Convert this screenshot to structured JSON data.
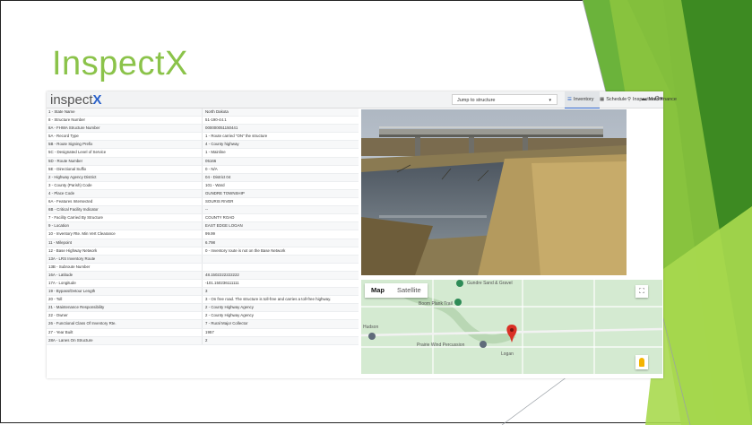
{
  "slide": {
    "title": "InspectX"
  },
  "app": {
    "logo": {
      "text": "inspect",
      "accent": "X"
    },
    "jump": {
      "label": "Jump to structure",
      "caret": "▾"
    },
    "nav": [
      {
        "label": "Inventory",
        "icon": "list-icon",
        "active": true
      },
      {
        "label": "Schedule",
        "icon": "calendar-icon",
        "active": false
      },
      {
        "label": "Inspection",
        "icon": "search-icon",
        "active": false
      },
      {
        "label": "Maintenance",
        "icon": "truck-icon",
        "active": false
      }
    ],
    "settings_icon": "gear-icon"
  },
  "inventory": {
    "rows": [
      {
        "key": "1 - State Name",
        "value": "North Dakota"
      },
      {
        "key": "8 - Structure Number",
        "value": "51-190-44.1"
      },
      {
        "key": "8A - FHWA Structure Number",
        "value": "000000051150441"
      },
      {
        "key": "5A - Record Type",
        "value": "1 - Route carried \"ON\" the structure"
      },
      {
        "key": "5B - Route Signing Prefix",
        "value": "4 - County highway"
      },
      {
        "key": "5C - Designated Level of Service",
        "value": "1 - Mainline"
      },
      {
        "key": "5D - Route Number",
        "value": "05166"
      },
      {
        "key": "5E - Directional Suffix",
        "value": "0 - N/A"
      },
      {
        "key": "2 - Highway Agency District",
        "value": "04 - District 04"
      },
      {
        "key": "3 - County (Parish) Code",
        "value": "101 - Ward"
      },
      {
        "key": "4 - Place Code",
        "value": "GUNDRE TOWNSHIP"
      },
      {
        "key": "6A - Features Intersected",
        "value": "SOURIS RIVER"
      },
      {
        "key": "6B - Critical Facility Indicator",
        "value": "--"
      },
      {
        "key": "7 - Facility Carried By Structure",
        "value": "COUNTY ROAD"
      },
      {
        "key": "9 - Location",
        "value": "EAST EDGE LOGAN"
      },
      {
        "key": "10 - Inventory Rte. Min Vert Clearance",
        "value": "99.99"
      },
      {
        "key": "11 - Milepoint",
        "value": "6.798"
      },
      {
        "key": "12 - Base Highway Network",
        "value": "0 - Inventory route is not on the Base Network"
      },
      {
        "key": "13A - LRS Inventory Route",
        "value": ""
      },
      {
        "key": "13B - Subroute Number",
        "value": ""
      },
      {
        "key": "16A - Latitude",
        "value": "48.1502222222222"
      },
      {
        "key": "17A - Longitude",
        "value": "-101.150236111111"
      },
      {
        "key": "19 - Bypass/Detour Length",
        "value": "3"
      },
      {
        "key": "20 - Toll",
        "value": "3 - On free road. The structure is toll-free and carries a toll-free highway."
      },
      {
        "key": "21 - Maintenance Responsibility",
        "value": "2 - County Highway Agency"
      },
      {
        "key": "22 - Owner",
        "value": "2 - County Highway Agency"
      },
      {
        "key": "26 - Functional Class Of Inventory Rte.",
        "value": "7 - Rural Major Collector"
      },
      {
        "key": "27 - Year Built",
        "value": "1957"
      },
      {
        "key": "28A - Lanes On Structure",
        "value": "2"
      }
    ]
  },
  "map": {
    "tabs": [
      {
        "label": "Map",
        "selected": true
      },
      {
        "label": "Satellite",
        "selected": false
      }
    ],
    "places": [
      "Gundre Sand & Gravel",
      "Boom Plank Trail",
      "Prairie Wind Percussion",
      "Logan",
      "Hudson"
    ]
  },
  "colors": {
    "accent": "#8bc34a",
    "brand_blue": "#2b62c9"
  }
}
